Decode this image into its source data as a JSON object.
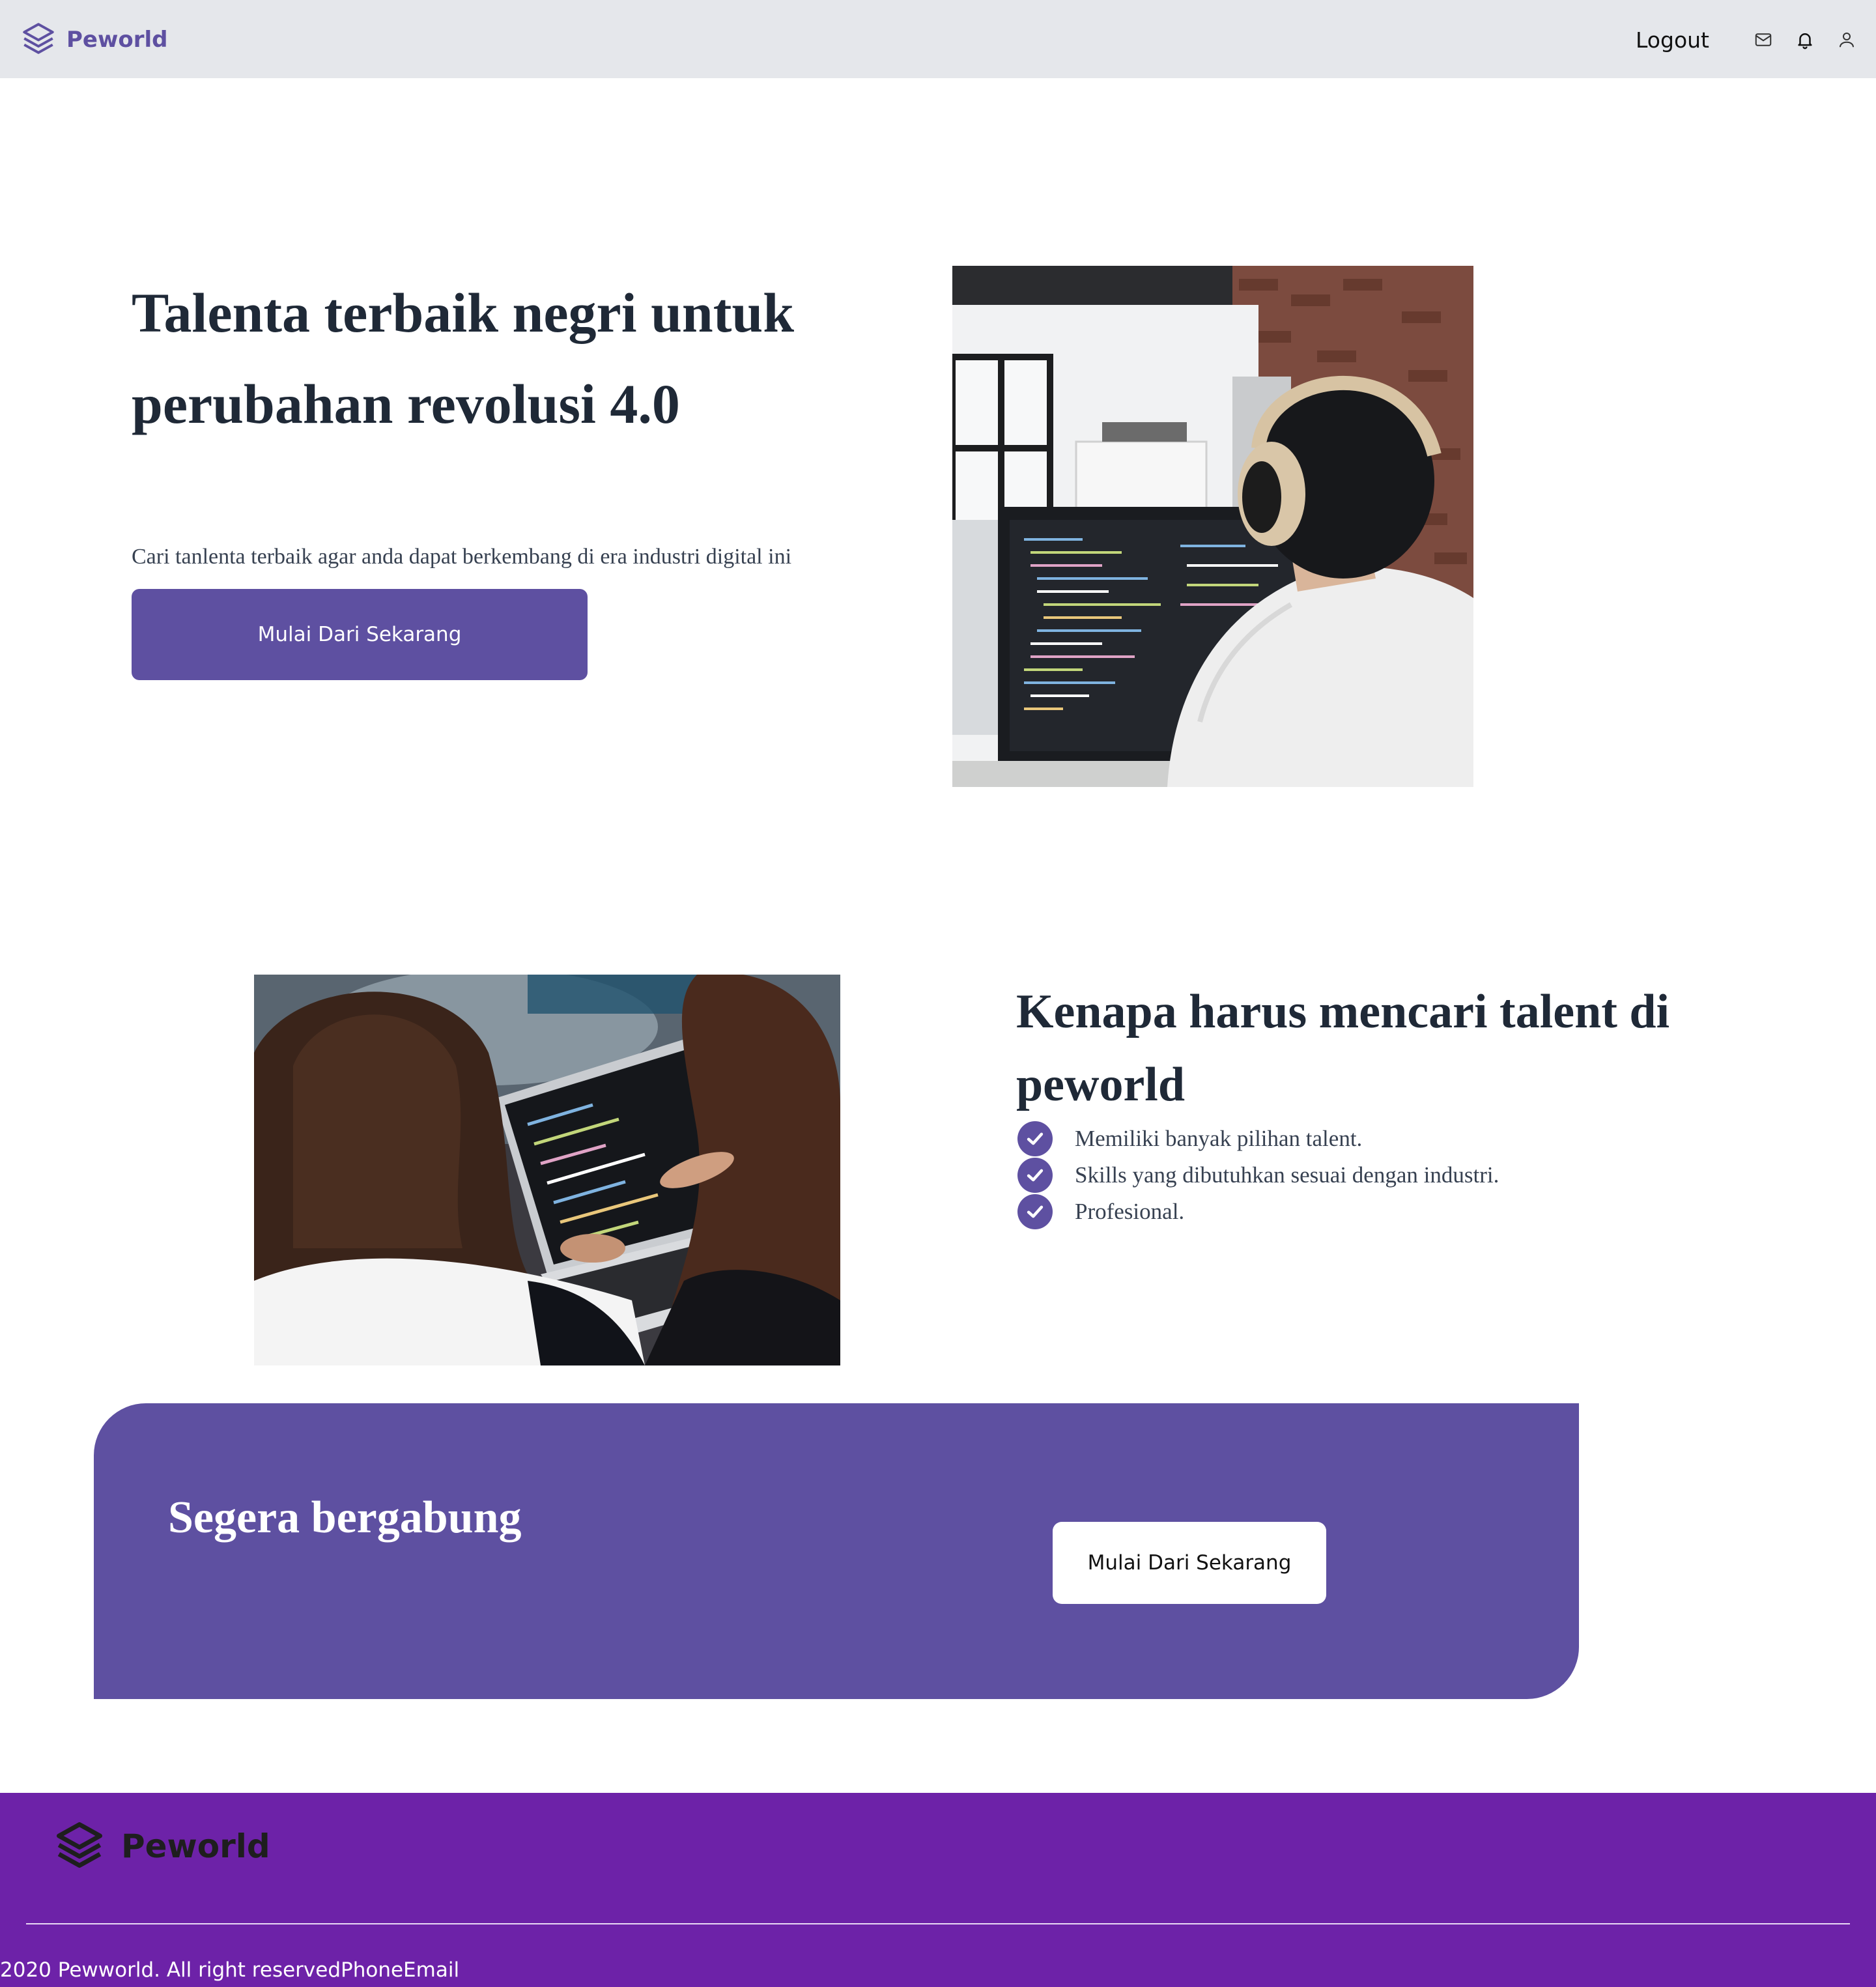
{
  "navbar": {
    "brand": "Peworld",
    "logout": "Logout",
    "icons": [
      "mail-icon",
      "bell-icon",
      "user-icon"
    ]
  },
  "hero": {
    "title": "Talenta terbaik negri untuk perubahan revolusi 4.0",
    "subtitle": "Cari tanlenta terbaik agar anda dapat berkembang di era industri digital ini",
    "button": "Mulai Dari Sekarang"
  },
  "why": {
    "title": "Kenapa harus mencari talent di peworld",
    "items": [
      "Memiliki banyak pilihan talent.",
      "Skills yang dibutuhkan sesuai dengan industri.",
      "Profesional."
    ]
  },
  "cta": {
    "title": "Segera bergabung",
    "button": "Mulai Dari Sekarang"
  },
  "footer": {
    "brand": "Peworld",
    "copyright": "2020 Pewworld. All right reserved",
    "phone": "Phone",
    "email": "Email"
  },
  "colors": {
    "primary": "#5e50a1",
    "footer": "#6d22a8",
    "navbar": "#e5e7eb"
  }
}
